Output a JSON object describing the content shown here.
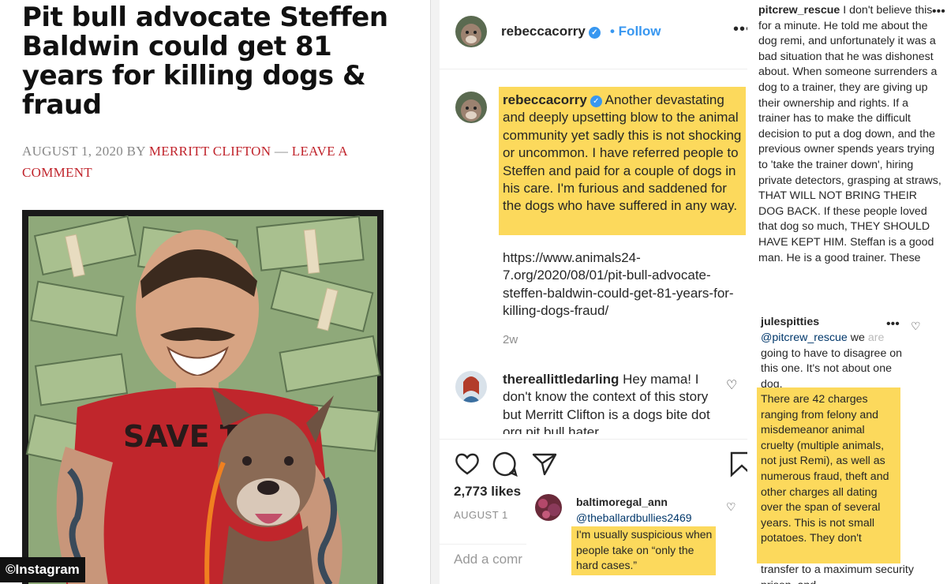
{
  "article": {
    "title": "Pit bull advocate Steffen Baldwin could get 81 years for killing dogs & fraud",
    "date": "AUGUST 1, 2020",
    "by": "BY",
    "author": "MERRITT CLIFTON",
    "separator": "—",
    "leave_comment": "LEAVE A COMMENT",
    "shirt_text": "SAVE TH"
  },
  "watermark": "©Instagram",
  "instagram": {
    "header": {
      "username": "rebeccacorry",
      "follow": "• Follow",
      "more": "•••"
    },
    "caption": {
      "username": "rebeccacorry",
      "text": "Another devastating and deeply upsetting blow to the animal community yet sadly this is not shocking or uncommon. I have referred people to Steffen and paid for a couple of dogs in his care. I'm furious and saddened for the dogs who have suffered in any way.",
      "link": "https://www.animals24-7.org/2020/08/01/pit-bull-advocate-steffen-baldwin-could-get-81-years-for-killing-dogs-fraud/",
      "time": "2w"
    },
    "comment1": {
      "username": "thereallittledarling",
      "text": "Hey mama! I don't know the context of this story but Merritt Clifton is a dogs bite dot org pit bull hater"
    },
    "likes": "2,773 likes",
    "date": "AUGUST 1",
    "add_comment_placeholder": "Add a comr",
    "popup_comment": {
      "username": "baltimoregal_ann",
      "mention": "@theballardbullies2469",
      "text": "I'm usually suspicious when people take on “only the hard cases.”"
    }
  },
  "right_comments": {
    "c1": {
      "username": "pitcrew_rescue",
      "text": "I don't believe this for a minute. He told me about the dog remi, and unfortunately it was a bad situation that he was dishonest about. When someone surrenders a dog to a trainer, they are giving up their ownership and rights. If a trainer has to make the difficult decision to put a dog down, and the previous owner spends years trying to 'take the trainer down', hiring private detectors, grasping at straws, THAT WILL NOT BRING THEIR DOG BACK. If these people loved that dog so much, THEY SHOULD HAVE KEPT HIM. Steffan is a good man. He is a good trainer. These"
    },
    "c2": {
      "username": "julespitties",
      "mention": "@pitcrew_rescue",
      "intro_a": "we",
      "intro_faded": "are",
      "intro_b": "going to have to disagree on this one. It's not about one dog.",
      "highlighted": "There are 42 charges ranging from felony and misdemeanor animal cruelty (multiple animals, not just Remi), as well as numerous fraud, theft and other charges all dating over the span of several years. This is not small potatoes. They don't",
      "tail": "transfer to a maximum security prison, and"
    }
  },
  "colors": {
    "highlight": "#fcd95c",
    "ig_blue": "#3897f0",
    "article_red": "#c0242c",
    "mention": "#00376b"
  },
  "icons": [
    "heart-icon",
    "comment-icon",
    "share-icon",
    "bookmark-icon",
    "verified-icon",
    "more-icon"
  ]
}
